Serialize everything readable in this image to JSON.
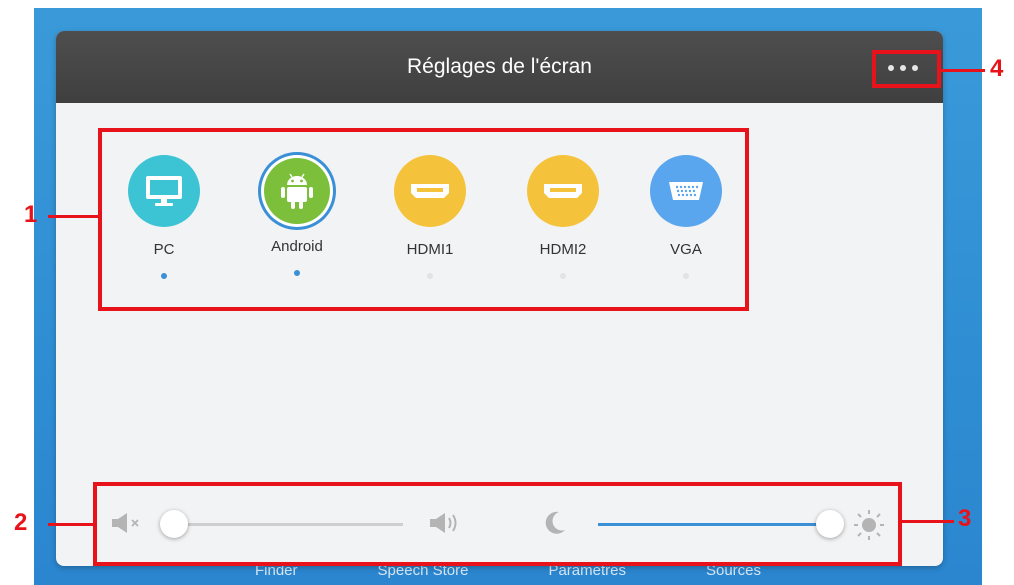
{
  "dialog": {
    "title": "Réglages de l'écran",
    "more_icon": "more-dots-icon"
  },
  "sources": [
    {
      "label": "PC",
      "icon": "monitor-icon",
      "color": "#3cc3d4",
      "active": true
    },
    {
      "label": "Android",
      "icon": "android-icon",
      "color": "#7bbf3a",
      "active": true,
      "selected": true
    },
    {
      "label": "HDMI1",
      "icon": "hdmi-icon",
      "color": "#f5c33b",
      "active": false
    },
    {
      "label": "HDMI2",
      "icon": "hdmi-icon",
      "color": "#f5c33b",
      "active": false
    },
    {
      "label": "VGA",
      "icon": "vga-icon",
      "color": "#5aa6ee",
      "active": false
    }
  ],
  "volume": {
    "level": 0.0,
    "min_icon": "mute-icon",
    "max_icon": "speaker-icon"
  },
  "brightness": {
    "level": 1.0,
    "min_icon": "moon-icon",
    "max_icon": "sun-icon"
  },
  "taskbar": [
    "Finder",
    "Speech Store",
    "Paramètres",
    "Sources"
  ],
  "callouts": [
    "1",
    "2",
    "3",
    "4"
  ],
  "colors": {
    "annotation": "#e8131a",
    "accent": "#3a8fd6",
    "active_dot": "#3a8fd6",
    "inactive_dot": "#e3e3e3"
  }
}
